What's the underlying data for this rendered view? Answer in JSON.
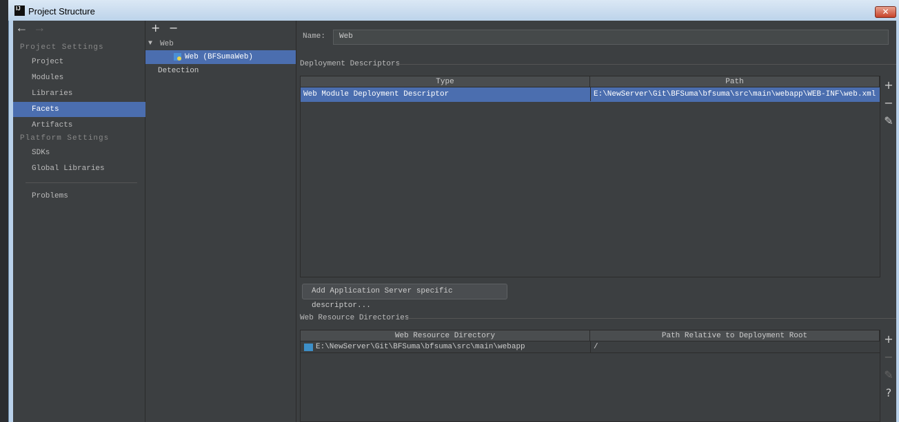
{
  "window": {
    "title": "Project Structure",
    "close": "✕"
  },
  "left": {
    "back": "←",
    "forward": "→",
    "project_settings": "Project Settings",
    "project_items": [
      "Project",
      "Modules",
      "Libraries",
      "Facets",
      "Artifacts"
    ],
    "platform_settings": "Platform Settings",
    "platform_items": [
      "SDKs",
      "Global Libraries"
    ],
    "problems": "Problems"
  },
  "middle": {
    "add": "+",
    "remove": "−",
    "tree_root": "Web",
    "tree_child": "Web (BFSumaWeb)",
    "detection": "Detection"
  },
  "right": {
    "name_label": "Name:",
    "name_value": "Web",
    "deployment_title": "Deployment Descriptors",
    "dd_headers": [
      "Type",
      "Path"
    ],
    "dd_rows": [
      {
        "type": "Web Module Deployment Descriptor",
        "path": "E:\\NewServer\\Git\\BFSuma\\bfsuma\\src\\main\\webapp\\WEB-INF\\web.xml"
      }
    ],
    "add_server_button": "Add Application Server specific descriptor...",
    "wrd_title": "Web Resource Directories",
    "wrd_headers": [
      "Web Resource Directory",
      "Path Relative to Deployment Root"
    ],
    "wrd_rows": [
      {
        "dir": "E:\\NewServer\\Git\\BFSuma\\bfsuma\\src\\main\\webapp",
        "rel": "/"
      }
    ],
    "tools": {
      "add": "+",
      "remove": "−",
      "edit": "✎",
      "help": "?"
    }
  }
}
